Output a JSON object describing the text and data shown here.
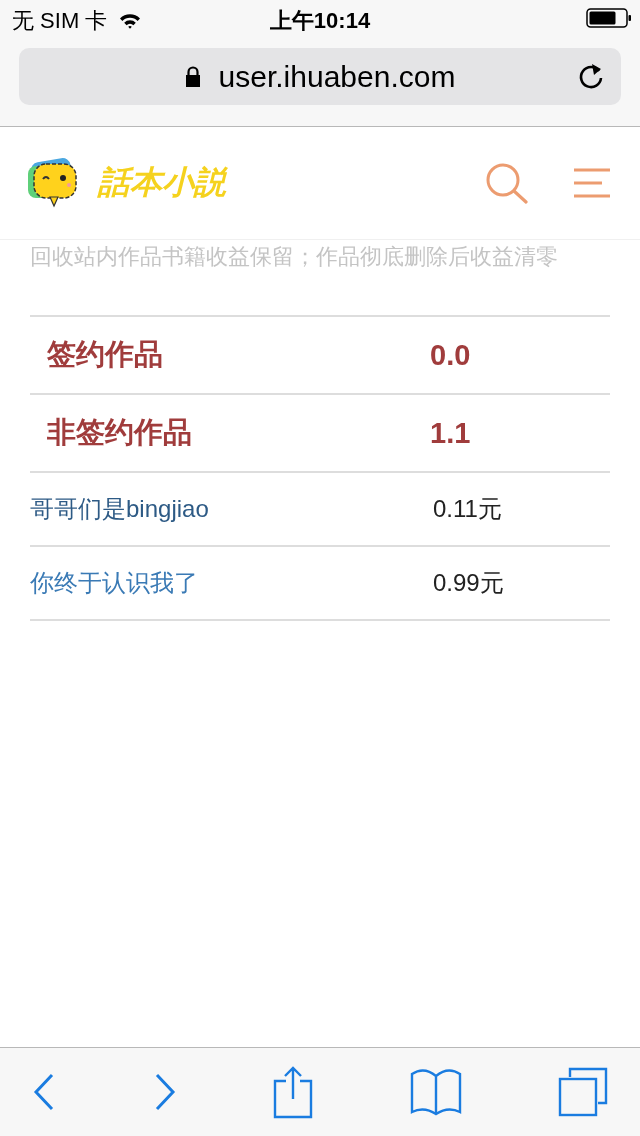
{
  "status_bar": {
    "carrier": "无 SIM 卡",
    "time": "上午10:14"
  },
  "address_bar": {
    "url": "user.ihuaben.com"
  },
  "header": {
    "logo_text": "話本小説"
  },
  "notice": "回收站内作品书籍收益保留；作品彻底删除后收益清零",
  "rows": [
    {
      "kind": "summary",
      "label": "签约作品",
      "value": "0.0"
    },
    {
      "kind": "summary",
      "label": "非签约作品",
      "value": "1.1"
    },
    {
      "kind": "work",
      "label": "哥哥们是bingjiao",
      "value": "0.11元"
    },
    {
      "kind": "work",
      "label": "你终于认识我了",
      "value": "0.99元"
    }
  ]
}
